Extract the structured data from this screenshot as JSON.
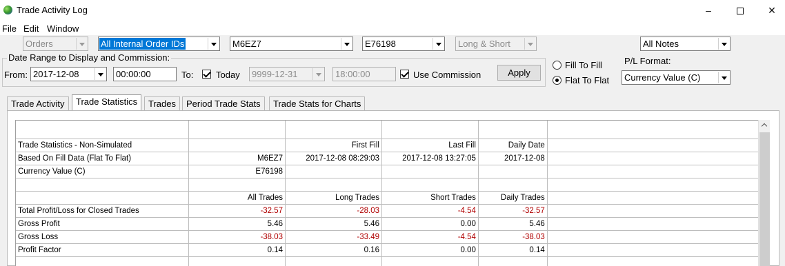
{
  "window": {
    "title": "Trade Activity Log"
  },
  "menu": [
    "File",
    "Edit",
    "Window"
  ],
  "toolbar": {
    "orders": "Orders",
    "order_ids": "All Internal Order IDs",
    "symbol": "M6EZ7",
    "account": "E76198",
    "direction": "Long & Short",
    "notes": "All Notes"
  },
  "date_range": {
    "legend": "Date Range to Display and Commission:",
    "from_label": "From:",
    "from_date": "2017-12-08",
    "from_time": "00:00:00",
    "to_label": "To:",
    "today_label": "Today",
    "today_checked": true,
    "to_date": "9999-12-31",
    "to_time": "18:00:00",
    "use_commission_label": "Use Commission",
    "use_commission_checked": true,
    "apply": "Apply"
  },
  "fill_mode": {
    "fill_to_fill": "Fill To Fill",
    "flat_to_flat": "Flat To Flat",
    "selected": "flat_to_flat"
  },
  "pl_format": {
    "label": "P/L Format:",
    "value": "Currency Value (C)"
  },
  "tabs": [
    "Trade Activity",
    "Trade Statistics",
    "Trades",
    "Period Trade Stats",
    "Trade Stats for Charts"
  ],
  "active_tab": 1,
  "colors": {
    "negative": "#b00000",
    "selection": "#0078d7"
  },
  "stats_table": {
    "rows": [
      [
        "",
        "",
        "",
        "",
        "",
        ""
      ],
      [
        "Trade Statistics - Non-Simulated",
        "",
        "First Fill",
        "Last Fill",
        "Daily Date",
        ""
      ],
      [
        "Based On Fill Data (Flat To Flat)",
        "M6EZ7",
        "2017-12-08  08:29:03",
        "2017-12-08  13:27:05",
        "2017-12-08",
        ""
      ],
      [
        "Currency Value (C)",
        "E76198",
        "",
        "",
        "",
        ""
      ],
      [
        "",
        "",
        "",
        "",
        "",
        ""
      ],
      [
        "",
        "All Trades",
        "Long Trades",
        "Short Trades",
        "Daily Trades",
        ""
      ],
      [
        "Total Profit/Loss for Closed Trades",
        "-32.57",
        "-28.03",
        "-4.54",
        "-32.57",
        ""
      ],
      [
        "Gross Profit",
        "5.46",
        "5.46",
        "0.00",
        "5.46",
        ""
      ],
      [
        "Gross Loss",
        "-38.03",
        "-33.49",
        "-4.54",
        "-38.03",
        ""
      ],
      [
        "Profit Factor",
        "0.14",
        "0.16",
        "0.00",
        "0.14",
        ""
      ],
      [
        "",
        "",
        "",
        "",
        "",
        ""
      ]
    ]
  }
}
